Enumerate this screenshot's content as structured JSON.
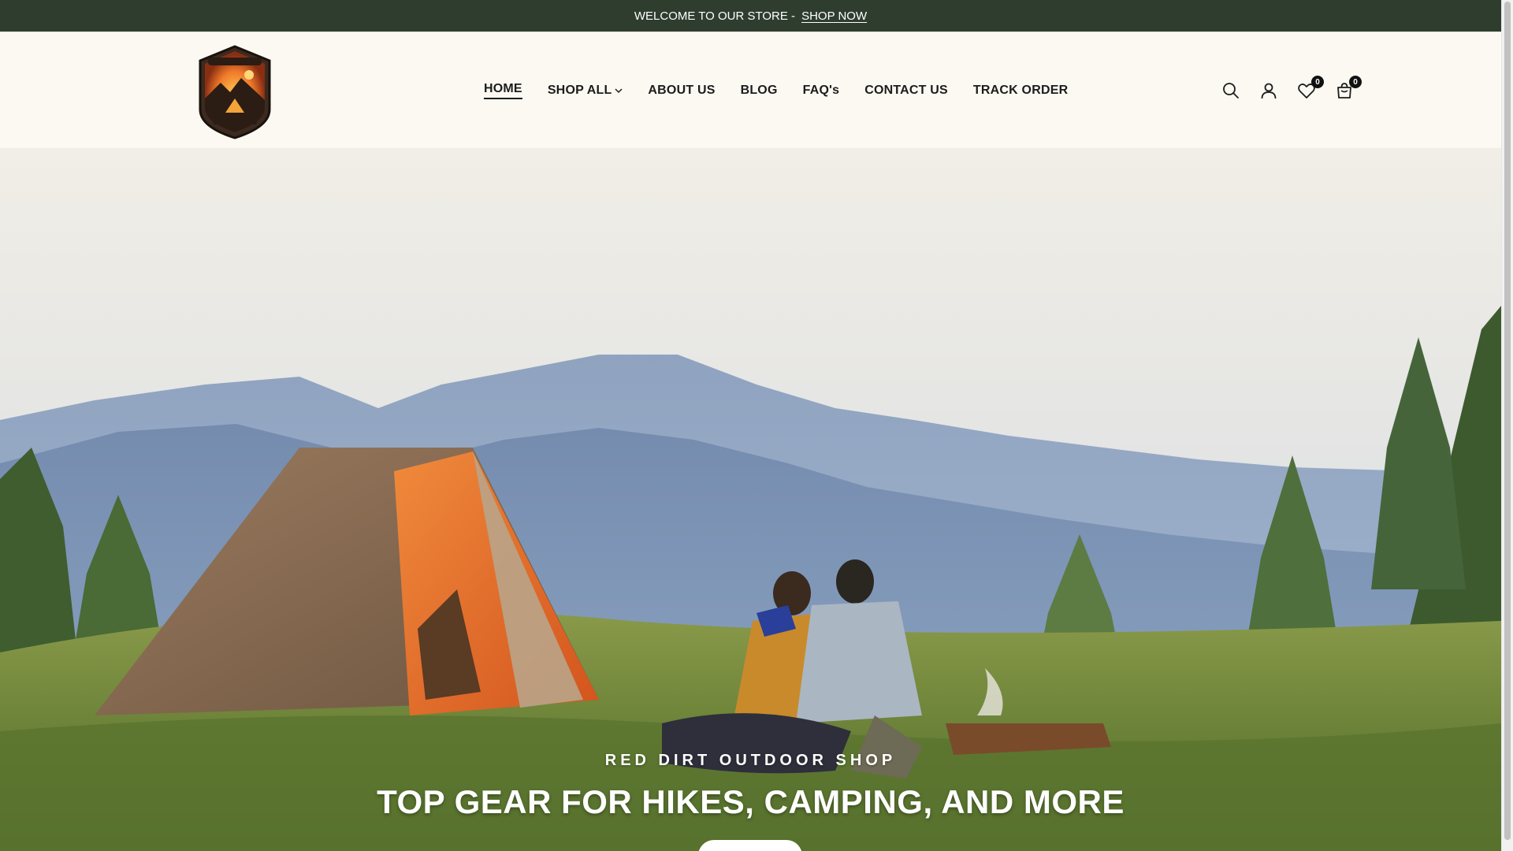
{
  "announcement": {
    "text": "WELCOME TO OUR STORE -",
    "link": "SHOP NOW"
  },
  "logo": {
    "alt": "Red Dirt Outdoor Shop"
  },
  "nav": {
    "items": [
      {
        "label": "HOME",
        "active": true
      },
      {
        "label": "SHOP ALL",
        "dropdown": true
      },
      {
        "label": "ABOUT US"
      },
      {
        "label": "BLOG"
      },
      {
        "label": "FAQ's"
      },
      {
        "label": "CONTACT US"
      },
      {
        "label": "TRACK ORDER"
      }
    ]
  },
  "header_icons": {
    "search": "search-icon",
    "account": "user-icon",
    "wishlist": "heart-icon",
    "wishlist_count": "0",
    "cart": "cart-icon",
    "cart_count": "0"
  },
  "hero": {
    "subtitle": "RED DIRT OUTDOOR SHOP",
    "title": "TOP GEAR FOR HIKES, CAMPING, AND MORE"
  },
  "colors": {
    "announcement_bg": "#2f3d2f",
    "header_bg": "#fbf9f2",
    "text_dark": "#1c1c1c",
    "tent_orange": "#e2672a"
  }
}
